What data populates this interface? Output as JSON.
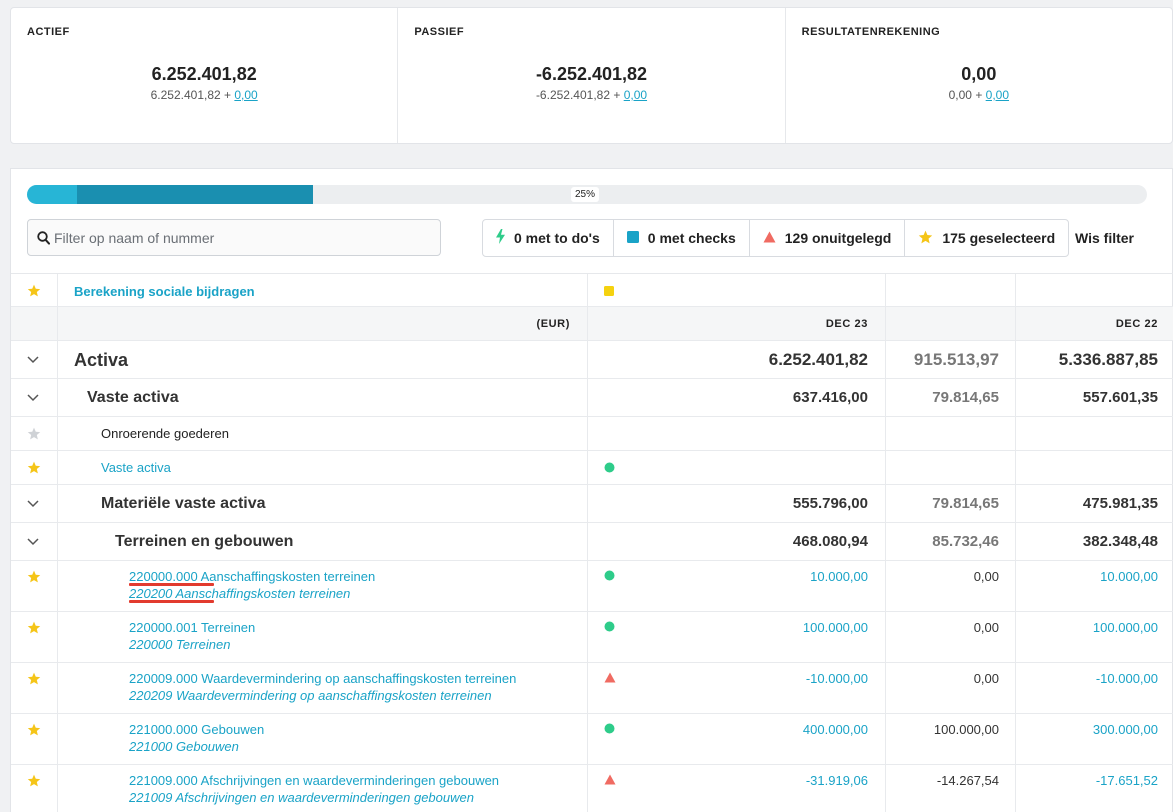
{
  "summary": [
    {
      "label": "ACTIEF",
      "value": "6.252.401,82",
      "sub_base": "6.252.401,82 + ",
      "sub_link": "0,00"
    },
    {
      "label": "PASSIEF",
      "value": "-6.252.401,82",
      "sub_base": "-6.252.401,82 + ",
      "sub_link": "0,00"
    },
    {
      "label": "RESULTATENREKENING",
      "value": "0,00",
      "sub_base": "0,00 + ",
      "sub_link": "0,00"
    }
  ],
  "progress": {
    "percent_label": "25%",
    "done_fraction": 0.045,
    "active_fraction": 0.21
  },
  "search": {
    "placeholder": "Filter op naam of nummer",
    "value": ""
  },
  "filters": {
    "todos": "0 met to do's",
    "checks": "0 met checks",
    "unexplained": "129 onuitgelegd",
    "selected": "175 geselecteerd",
    "clear": "Wis filter"
  },
  "table": {
    "special_row": {
      "label": "Berekening sociale bijdragen"
    },
    "header": {
      "currency": "(EUR)",
      "col1": "DEC 23",
      "col2": "",
      "col3": "DEC 22"
    },
    "rows": {
      "activa": {
        "label": "Activa",
        "v1": "6.252.401,82",
        "v2": "915.513,97",
        "v3": "5.336.887,85"
      },
      "vaste": {
        "label": "Vaste activa",
        "v1": "637.416,00",
        "v2": "79.814,65",
        "v3": "557.601,35"
      },
      "onroerend": {
        "label": "Onroerende goederen"
      },
      "vaste_link": {
        "label": "Vaste activa"
      },
      "materiele": {
        "label": "Materiële vaste activa",
        "v1": "555.796,00",
        "v2": "79.814,65",
        "v3": "475.981,35"
      },
      "terreinen": {
        "label": "Terreinen en gebouwen",
        "v1": "468.080,94",
        "v2": "85.732,46",
        "v3": "382.348,48"
      },
      "acc1": {
        "line1": "220000.000 Aanschaffingskosten terreinen",
        "line2": "220200 Aanschaffingskosten terreinen",
        "v1": "10.000,00",
        "v2": "0,00",
        "v3": "10.000,00"
      },
      "acc2": {
        "line1": "220000.001 Terreinen",
        "line2": "220000 Terreinen",
        "v1": "100.000,00",
        "v2": "0,00",
        "v3": "100.000,00"
      },
      "acc3": {
        "line1": "220009.000 Waardevermindering op aanschaffingskosten terreinen",
        "line2": "220209 Waardevermindering op aanschaffingskosten terreinen",
        "v1": "-10.000,00",
        "v2": "0,00",
        "v3": "-10.000,00"
      },
      "acc4": {
        "line1": "221000.000 Gebouwen",
        "line2": "221000 Gebouwen",
        "v1": "400.000,00",
        "v2": "100.000,00",
        "v3": "300.000,00"
      },
      "acc5": {
        "line1": "221009.000 Afschrijvingen en waardeverminderingen gebouwen",
        "line2": "221009 Afschrijvingen en waardeverminderingen gebouwen",
        "v1": "-31.919,06",
        "v2": "-14.267,54",
        "v3": "-17.651,52"
      }
    }
  },
  "colors": {
    "teal": "#1aa3c7",
    "green": "#2ecc8a",
    "red": "#f06b62",
    "yellow": "#f5c518",
    "progress_light": "#27b5d6",
    "progress_dark": "#1a8fb0"
  }
}
